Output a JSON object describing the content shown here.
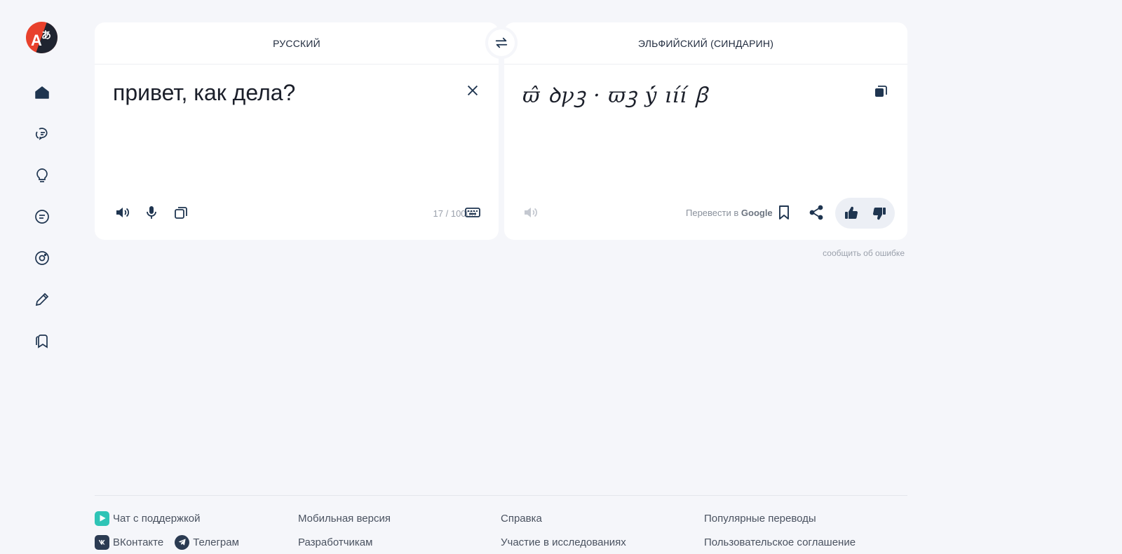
{
  "source_panel": {
    "language": "РУССКИЙ",
    "text": "привет, как дела?",
    "counter": "17 / 10000"
  },
  "target_panel": {
    "language": "ЭЛЬФИЙСКИЙ (СИНДАРИН)",
    "text": "ϖ̂ ꝺꝩꝫ · ϖꝫ ẏ́ ıı́ı́ ꞵ",
    "google_prefix": "Перевести в",
    "google_brand": "Google"
  },
  "report_error": "сообщить об ошибке",
  "footer": {
    "support_chat": "Чат с поддержкой",
    "vk": "ВКонтакте",
    "telegram": "Телеграм",
    "mobile": "Мобильная версия",
    "developers": "Разработчикам",
    "help": "Справка",
    "research": "Участие в исследованиях",
    "popular": "Популярные переводы",
    "agreement": "Пользовательское соглашение"
  },
  "colors": {
    "accent": "#1f3550",
    "logo_red": "#e8412c",
    "logo_dark": "#1f2430",
    "muted": "#9aa0ab",
    "background": "#f5f6fa"
  },
  "icons": {
    "sidebar": [
      "home-icon",
      "dialog-icon",
      "lightbulb-icon",
      "document-icon",
      "camera-icon",
      "pencil-icon",
      "bookmarks-icon"
    ]
  }
}
